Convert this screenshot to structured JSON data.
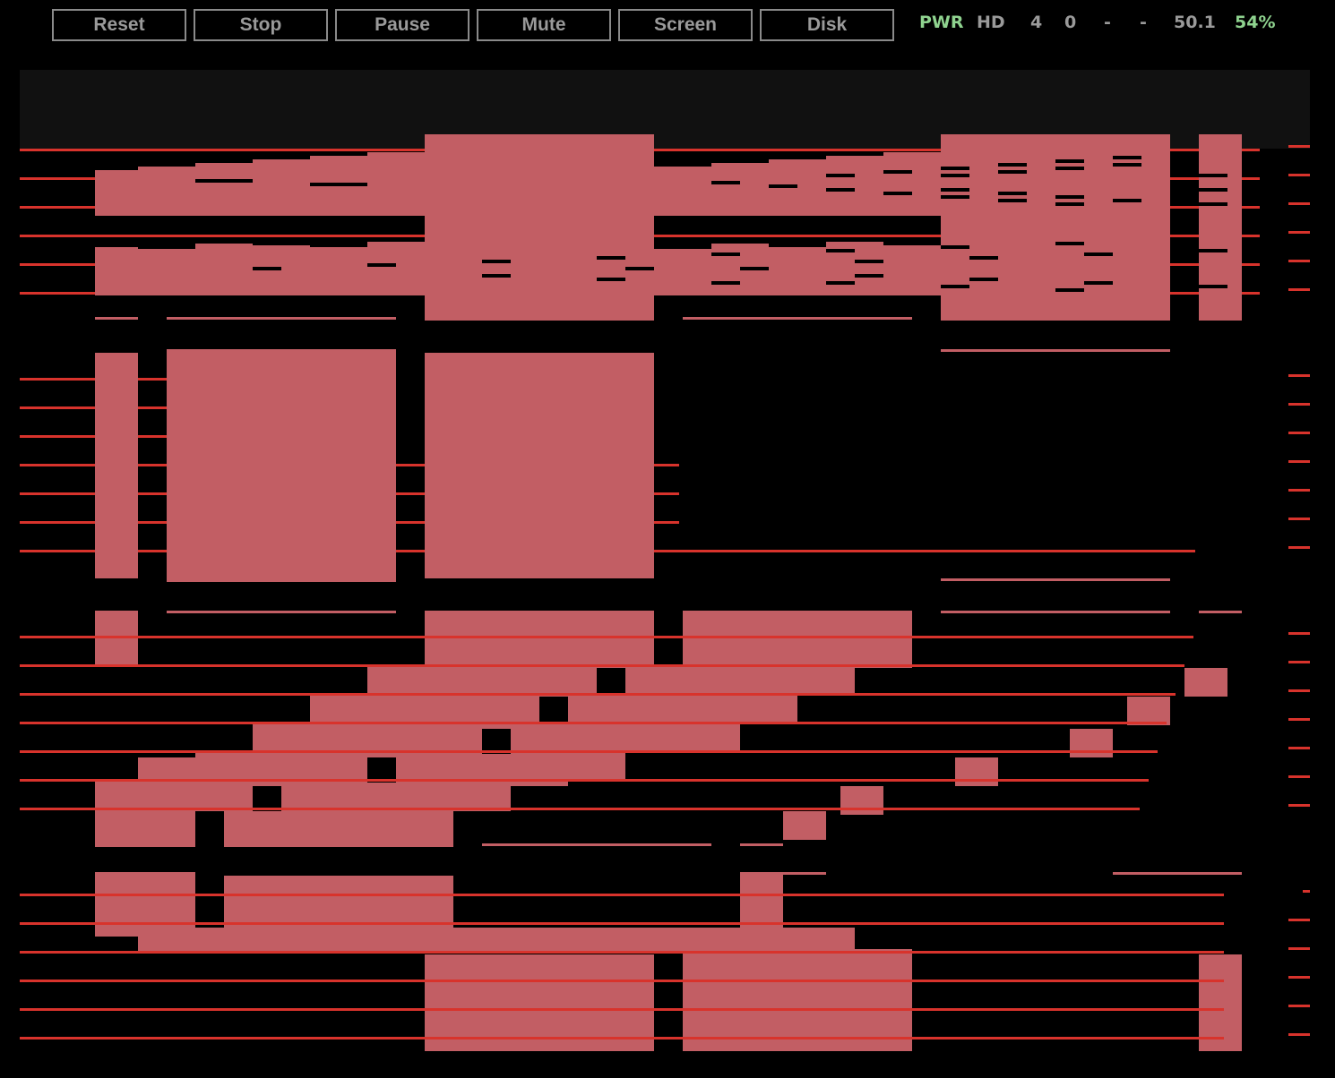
{
  "toolbar": {
    "buttons": [
      "Reset",
      "Stop",
      "Pause",
      "Mute",
      "Screen",
      "Disk"
    ]
  },
  "status": {
    "pwr": "PWR",
    "hd": "HD",
    "v1": "4",
    "v2": "0",
    "v3": "-",
    "v4": "-",
    "speed": "50.1",
    "percent": "54%"
  },
  "colors": {
    "block": "#c25e64",
    "line": "#d8332c",
    "status_on": "#8fd38f",
    "status_off": "#9a9a9a"
  }
}
